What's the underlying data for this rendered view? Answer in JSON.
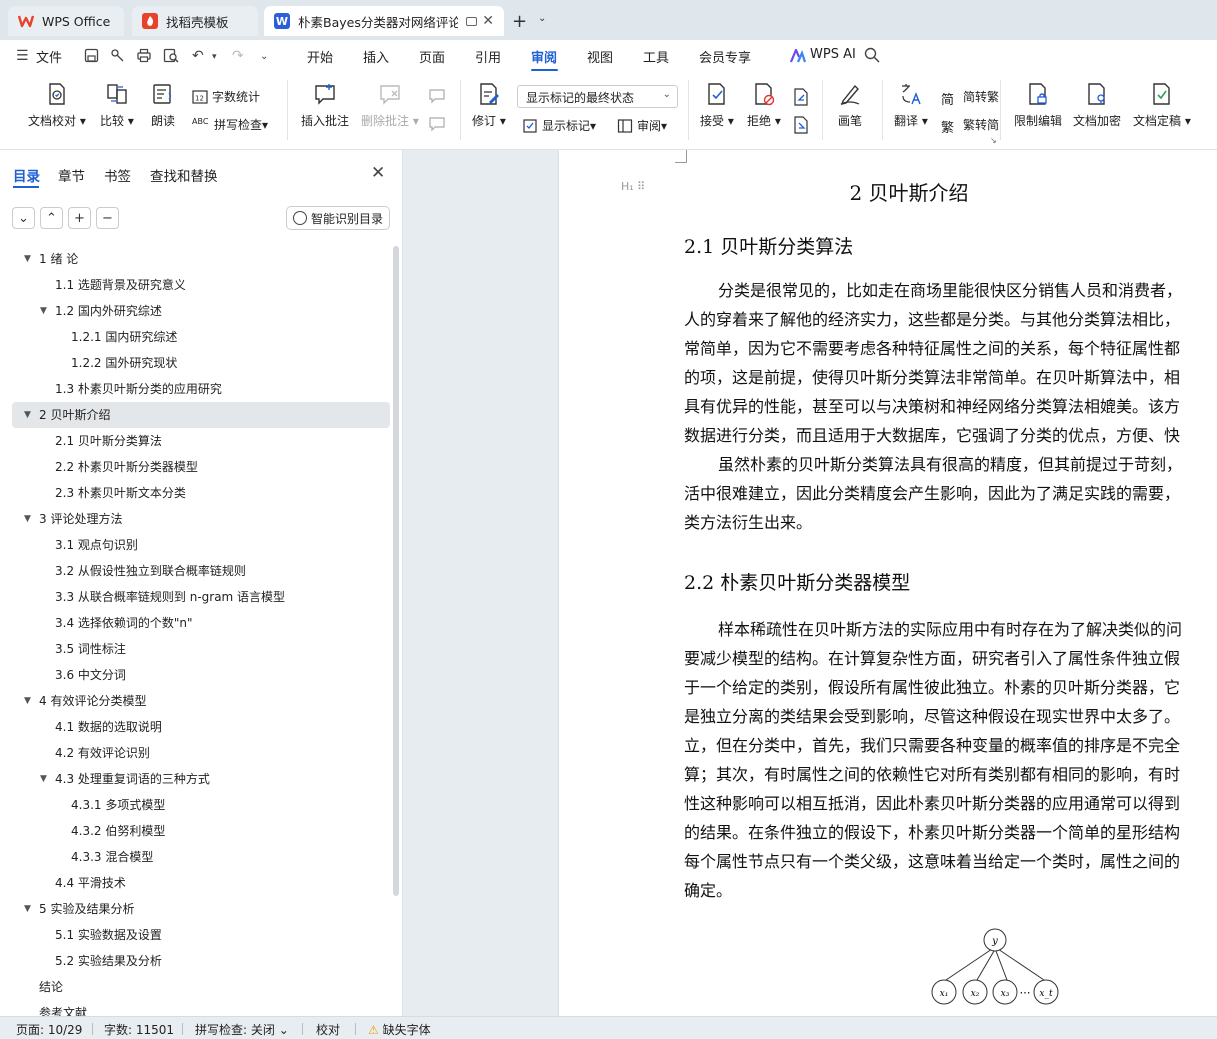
{
  "tabs": [
    {
      "label": "WPS Office",
      "icon": "wps-logo-icon",
      "color": "#e8412c"
    },
    {
      "label": "找稻壳模板",
      "icon": "docer-logo-icon",
      "color": "#e8412c"
    },
    {
      "label": "朴素Bayes分类器对网络评论者",
      "icon": "writer-logo-icon",
      "color": "#2b5fd9",
      "active": true
    }
  ],
  "menu": {
    "file": "文件",
    "items": [
      "开始",
      "插入",
      "页面",
      "引用",
      "审阅",
      "视图",
      "工具",
      "会员专享"
    ],
    "active": "审阅",
    "ai": "WPS AI"
  },
  "ribbon": {
    "doc_check": "文档校对",
    "compare": "比较",
    "read_aloud": "朗读",
    "word_count": "字数统计",
    "spell_check": "拼写检查",
    "insert_comment": "插入批注",
    "delete_comment": "删除批注",
    "revise": "修订",
    "markup_dropdown": "显示标记的最终状态",
    "show_markup": "显示标记",
    "review_pane": "审阅",
    "accept": "接受",
    "reject": "拒绝",
    "pen": "画笔",
    "translate": "翻译",
    "simp_to_trad": "简转繁",
    "trad_to_simp": "繁转简",
    "restrict_edit": "限制编辑",
    "encrypt": "文档加密",
    "finalize": "文档定稿"
  },
  "nav": {
    "tabs": [
      "目录",
      "章节",
      "书签",
      "查找和替换"
    ],
    "active_tab": "目录",
    "smart_btn": "智能识别目录",
    "toc": [
      {
        "text": "1  绪  论",
        "level": 1,
        "expanded": true
      },
      {
        "text": "1.1 选题背景及研究意义",
        "level": 2
      },
      {
        "text": "1.2 国内外研究综述",
        "level": 2,
        "expanded": true
      },
      {
        "text": "1.2.1 国内研究综述",
        "level": 3
      },
      {
        "text": "1.2.2 国外研究现状",
        "level": 3
      },
      {
        "text": "1.3 朴素贝叶斯分类的应用研究",
        "level": 2
      },
      {
        "text": "2  贝叶斯介绍",
        "level": 1,
        "expanded": true,
        "selected": true
      },
      {
        "text": "2.1 贝叶斯分类算法",
        "level": 2
      },
      {
        "text": "2.2 朴素贝叶斯分类器模型",
        "level": 2
      },
      {
        "text": "2.3 朴素贝叶斯文本分类",
        "level": 2
      },
      {
        "text": "3  评论处理方法",
        "level": 1,
        "expanded": true
      },
      {
        "text": "3.1 观点句识别",
        "level": 2
      },
      {
        "text": "3.2 从假设性独立到联合概率链规则",
        "level": 2
      },
      {
        "text": "3.3 从联合概率链规则到 n-gram 语言模型",
        "level": 2
      },
      {
        "text": "3.4 选择依赖词的个数\"n\"",
        "level": 2
      },
      {
        "text": "3.5 词性标注",
        "level": 2
      },
      {
        "text": "3.6 中文分词",
        "level": 2
      },
      {
        "text": "4  有效评论分类模型",
        "level": 1,
        "expanded": true
      },
      {
        "text": "4.1 数据的选取说明",
        "level": 2
      },
      {
        "text": "4.2 有效评论识别",
        "level": 2
      },
      {
        "text": "4.3 处理重复词语的三种方式",
        "level": 2,
        "expanded": true
      },
      {
        "text": "4.3.1 多项式模型",
        "level": 3
      },
      {
        "text": "4.3.2 伯努利模型",
        "level": 3
      },
      {
        "text": "4.3.3 混合模型",
        "level": 3
      },
      {
        "text": "4.4 平滑技术",
        "level": 2
      },
      {
        "text": "5  实验及结果分析",
        "level": 1,
        "expanded": true
      },
      {
        "text": "5.1 实验数据及设置",
        "level": 2
      },
      {
        "text": "5.2 实验结果及分析",
        "level": 2
      },
      {
        "text": "结论",
        "level": 1
      },
      {
        "text": "参考文献",
        "level": 1
      }
    ]
  },
  "doc": {
    "chapter_title": "2  贝叶斯介绍",
    "s21_title": "2.1 贝叶斯分类算法",
    "s21_p1": [
      "分类是很常见的，比如走在商场里能很快区分销售人员和消费者，",
      "人的穿着来了解他的经济实力，这些都是分类。与其他分类算法相比，",
      "常简单，因为它不需要考虑各种特征属性之间的关系，每个特征属性都",
      "的项，这是前提，使得贝叶斯分类算法非常简单。在贝叶斯算法中，相",
      "具有优异的性能，甚至可以与决策树和神经网络分类算法相媲美。该方",
      "数据进行分类，而且适用于大数据库，它强调了分类的优点，方便、快"
    ],
    "s21_p2": [
      "虽然朴素的贝叶斯分类算法具有很高的精度，但其前提过于苛刻，",
      "活中很难建立，因此分类精度会产生影响，因此为了满足实践的需要，",
      "类方法衍生出来。"
    ],
    "s22_title": "2.2 朴素贝叶斯分类器模型",
    "s22_p1": [
      "样本稀疏性在贝叶斯方法的实际应用中有时存在为了解决类似的问",
      "要减少模型的结构。在计算复杂性方面，研究者引入了属性条件独立假",
      "于一个给定的类别，假设所有属性彼此独立。朴素的贝叶斯分类器，它",
      "是独立分离的类结果会受到影响，尽管这种假设在现实世界中太多了。",
      "立，但在分类中，首先，我们只需要各种变量的概率值的排序是不完全",
      "算；其次，有时属性之间的依赖性它对所有类别都有相同的影响，有时",
      "性这种影响可以相互抵消，因此朴素贝叶斯分类器的应用通常可以得到",
      "的结果。在条件独立的假设下，朴素贝叶斯分类器一个简单的星形结构",
      "每个属性节点只有一个类父级，这意味着当给定一个类时，属性之间的",
      "确定。"
    ],
    "figure": {
      "root": "y",
      "leaves": [
        "x₁",
        "x₂",
        "x₃",
        "x_t"
      ],
      "ellipsis": "⋯"
    }
  },
  "status": {
    "page": "页面: 10/29",
    "words": "字数: 11501",
    "spell": "拼写检查: 关闭",
    "proof": "校对",
    "missing_font": "缺失字体"
  }
}
